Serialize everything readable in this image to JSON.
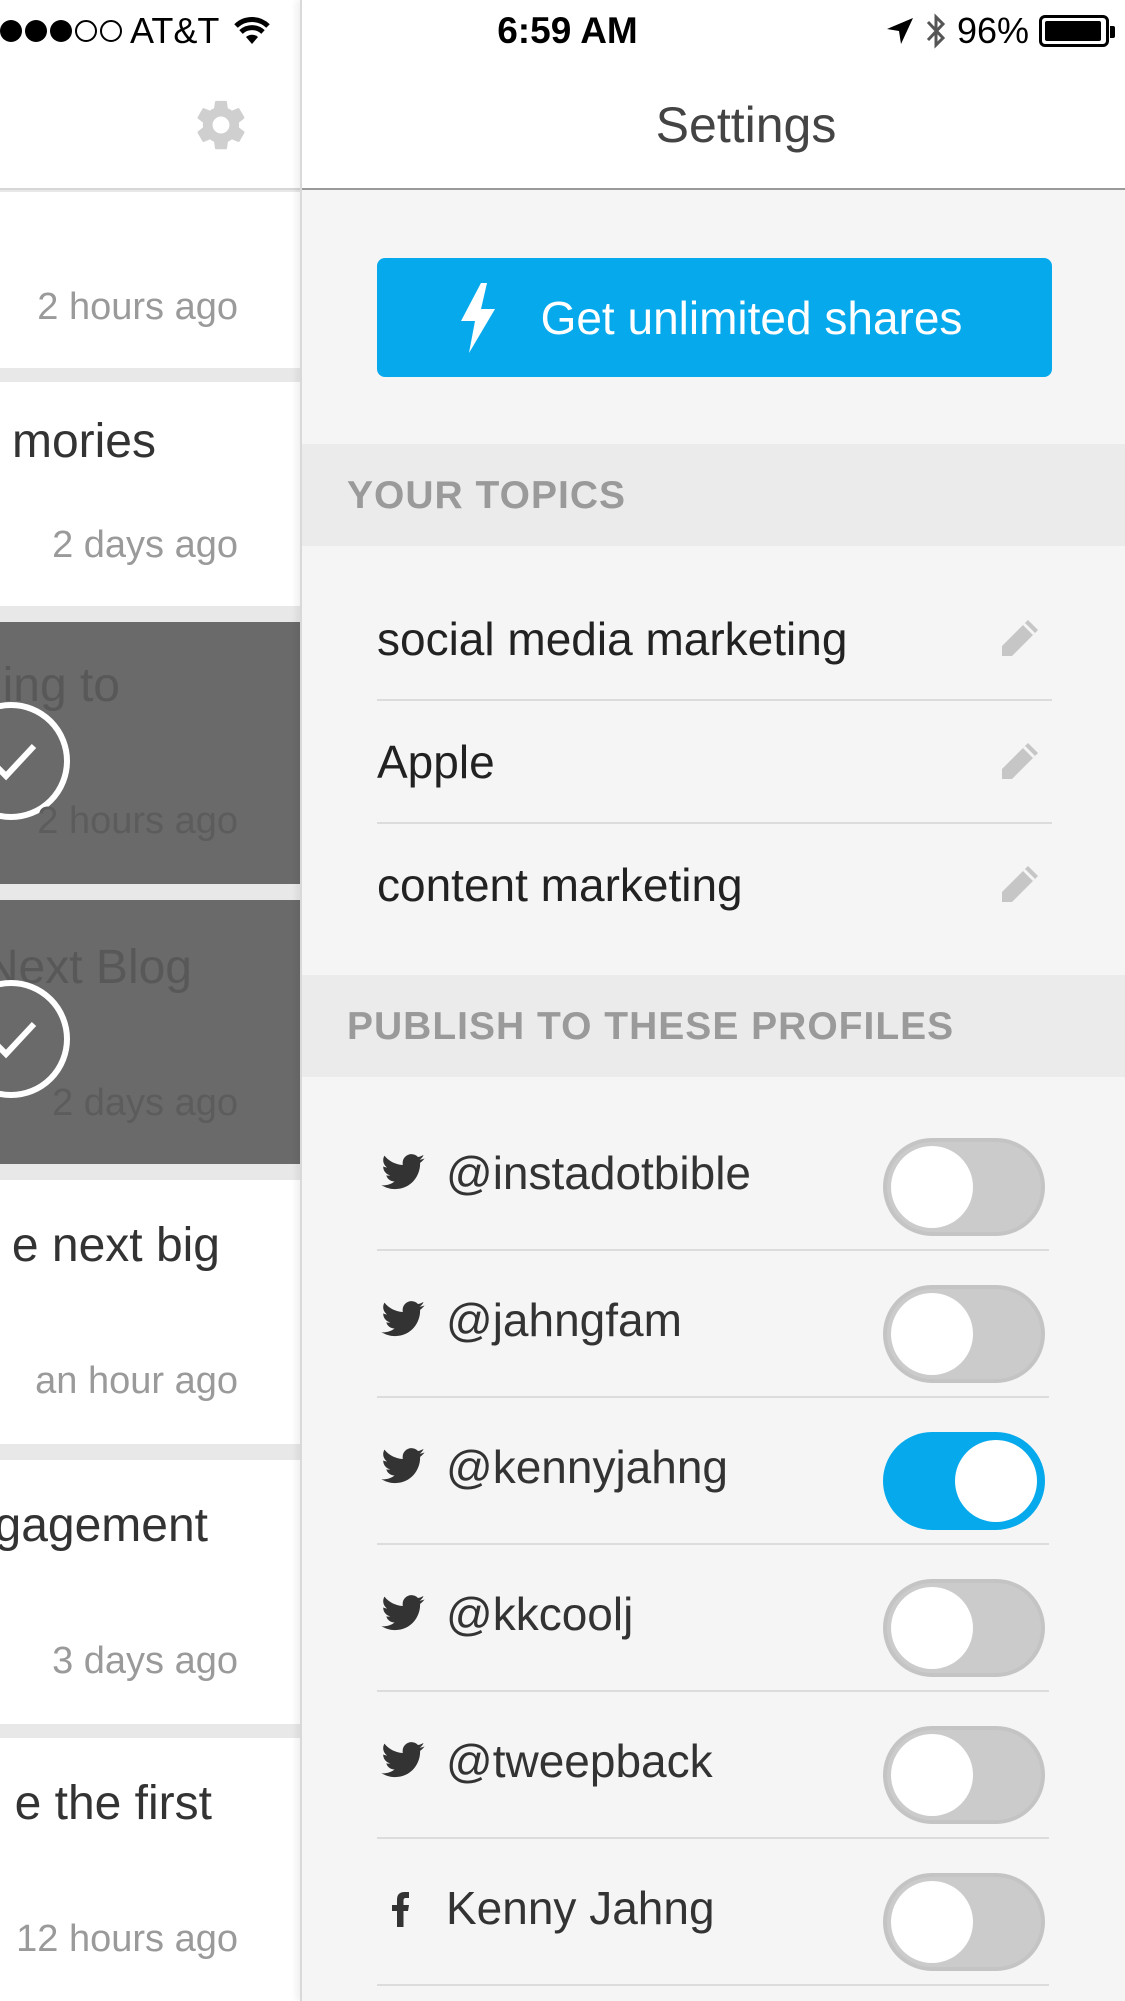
{
  "status_bar": {
    "carrier": "AT&T",
    "time": "6:59 AM",
    "battery": "96%",
    "battery_level": 0.96
  },
  "feed": {
    "cards": [
      {
        "title": "",
        "time": "2 hours ago",
        "selected": false
      },
      {
        "title": "mories",
        "time": "2 days ago",
        "selected": false
      },
      {
        "title": "ing to",
        "time": "2 hours ago",
        "selected": true
      },
      {
        "title": "Next Blog",
        "time": "2 days ago",
        "selected": true
      },
      {
        "title": "e next big",
        "time": "an hour ago",
        "selected": false
      },
      {
        "title": "gagement",
        "time": "3 days ago",
        "selected": false
      },
      {
        "title": "e the first",
        "time": "12 hours ago",
        "selected": false
      }
    ]
  },
  "settings": {
    "title": "Settings",
    "upgrade_label": "Get unlimited shares",
    "topics_header": "YOUR TOPICS",
    "topics": [
      "social media marketing",
      "Apple",
      "content marketing"
    ],
    "profiles_header": "PUBLISH TO THESE PROFILES",
    "profiles": [
      {
        "network": "twitter",
        "name": "@instadotbible",
        "enabled": false
      },
      {
        "network": "twitter",
        "name": "@jahngfam",
        "enabled": false
      },
      {
        "network": "twitter",
        "name": "@kennyjahng",
        "enabled": true
      },
      {
        "network": "twitter",
        "name": "@kkcoolj",
        "enabled": false
      },
      {
        "network": "twitter",
        "name": "@tweepback",
        "enabled": false
      },
      {
        "network": "facebook",
        "name": "Kenny Jahng",
        "enabled": false
      }
    ]
  },
  "colors": {
    "accent": "#06aaec",
    "toggle_off": "#cbcbcb",
    "section_bg": "#ebebeb",
    "drawer_bg": "#f5f5f5",
    "selected_card": "#6a6a6a"
  }
}
